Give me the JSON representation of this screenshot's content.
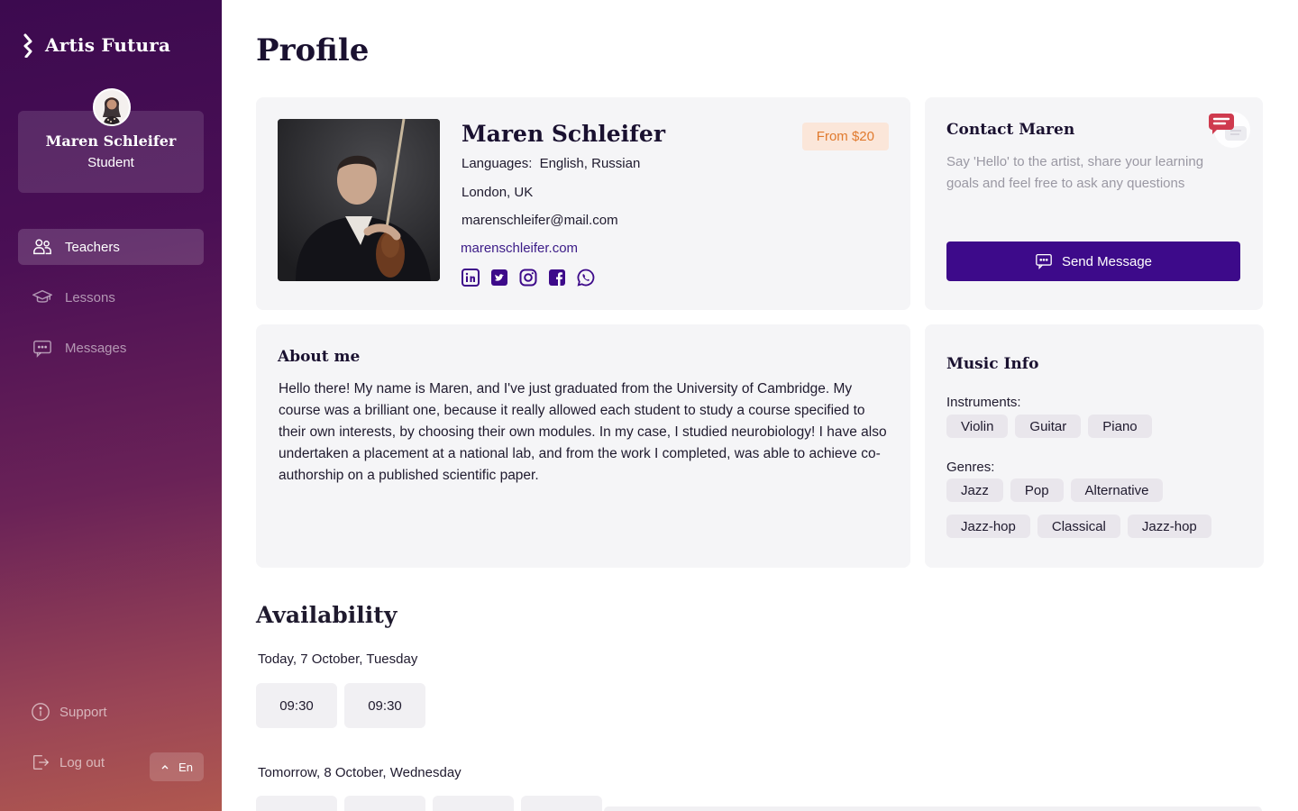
{
  "brand": {
    "name": "Artis Futura"
  },
  "user": {
    "name": "Maren Schleifer",
    "role": "Student"
  },
  "nav": {
    "teachers": "Teachers",
    "lessons": "Lessons",
    "messages": "Messages",
    "support": "Support",
    "logout": "Log out",
    "language": "En"
  },
  "page": {
    "title": "Profile"
  },
  "profile": {
    "name": "Maren Schleifer",
    "price": "From $20",
    "languages_label": "Languages:",
    "languages": "English, Russian",
    "location": "London, UK",
    "email": "marenschleifer@mail.com",
    "website": "marenschleifer.com",
    "socials": [
      "linkedin-icon",
      "twitter-icon",
      "instagram-icon",
      "facebook-icon",
      "whatsapp-icon"
    ]
  },
  "contact": {
    "title": "Contact Maren",
    "description": "Say 'Hello' to the artist, share your learning goals and feel free to ask any questions",
    "button": "Send Message"
  },
  "about": {
    "title": "About me",
    "text": "Hello there! My name is Maren, and I've just graduated from the University of Cambridge. My course was a brilliant one, because it really allowed each student to study a course specified to their own interests, by choosing their own modules. In my case, I studied neurobiology! I have also undertaken a placement at a national lab, and from the work I completed, was able to achieve co-authorship on a published scientific paper."
  },
  "music": {
    "title": "Music Info",
    "instruments_label": "Instruments:",
    "instruments": [
      "Violin",
      "Guitar",
      "Piano"
    ],
    "genres_label": "Genres:",
    "genres": [
      "Jazz",
      "Pop",
      "Alternative",
      "Jazz-hop",
      "Classical",
      "Jazz-hop"
    ]
  },
  "availability": {
    "title": "Availability",
    "days": [
      {
        "label": "Today, 7 October, Tuesday",
        "slots": [
          "09:30",
          "09:30"
        ]
      },
      {
        "label": "Tomorrow, 8 October, Wednesday",
        "slots": [
          "",
          "",
          "",
          ""
        ]
      }
    ]
  },
  "colors": {
    "accent": "#3d0a8a",
    "price_text": "#e07a2e",
    "price_bg": "#fbe6d9",
    "card_bg": "#f5f5f7"
  }
}
